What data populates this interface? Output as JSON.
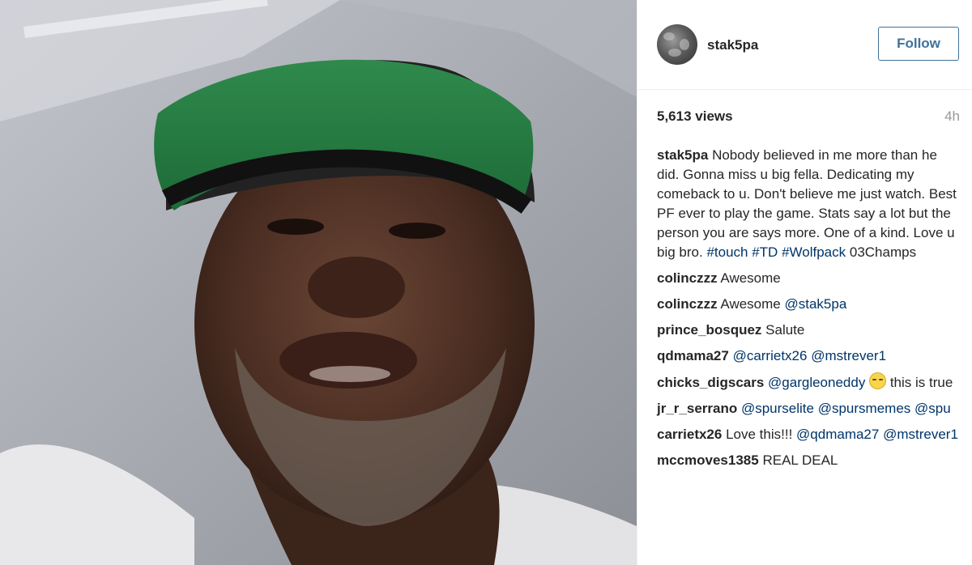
{
  "post": {
    "username": "stak5pa",
    "follow_label": "Follow",
    "views": "5,613 views",
    "time": "4h"
  },
  "caption": {
    "user": "stak5pa",
    "text": "Nobody believed in me more than he did. Gonna miss u big fella. Dedicating my comeback to u. Don't believe me just watch. Best PF ever to play the game. Stats say a lot but the person you are says more. One of a kind. Love u big bro.",
    "hashtag_touch": "#touch",
    "hashtag_td": "#TD",
    "hashtag_wolfpack": "#Wolfpack",
    "tail": "03Champs"
  },
  "comments": [
    {
      "user": "colinczzz",
      "text": "Awesome"
    },
    {
      "user": "colinczzz",
      "text": "Awesome",
      "mention": "@stak5pa"
    },
    {
      "user": "prince_bosquez",
      "text": "Salute"
    },
    {
      "user": "qdmama27",
      "mention1": "@carrietx26",
      "mention2": "@mstrever1"
    },
    {
      "user": "chicks_digscars",
      "mention": "@gargleoneddy",
      "emoji": "relieved-face-emoji",
      "text": "this is true"
    },
    {
      "user": "jr_r_serrano",
      "mention1": "@spurselite",
      "mention2": "@spursmemes",
      "mention3": "@spu"
    },
    {
      "user": "carrietx26",
      "text": "Love this!!!",
      "mention1": "@qdmama27",
      "mention2": "@mstrever1"
    },
    {
      "user": "mccmoves1385",
      "text": "REAL DEAL"
    }
  ],
  "colors": {
    "link": "#003569",
    "follow": "#3f729b",
    "text": "#262626",
    "muted": "#999999"
  }
}
